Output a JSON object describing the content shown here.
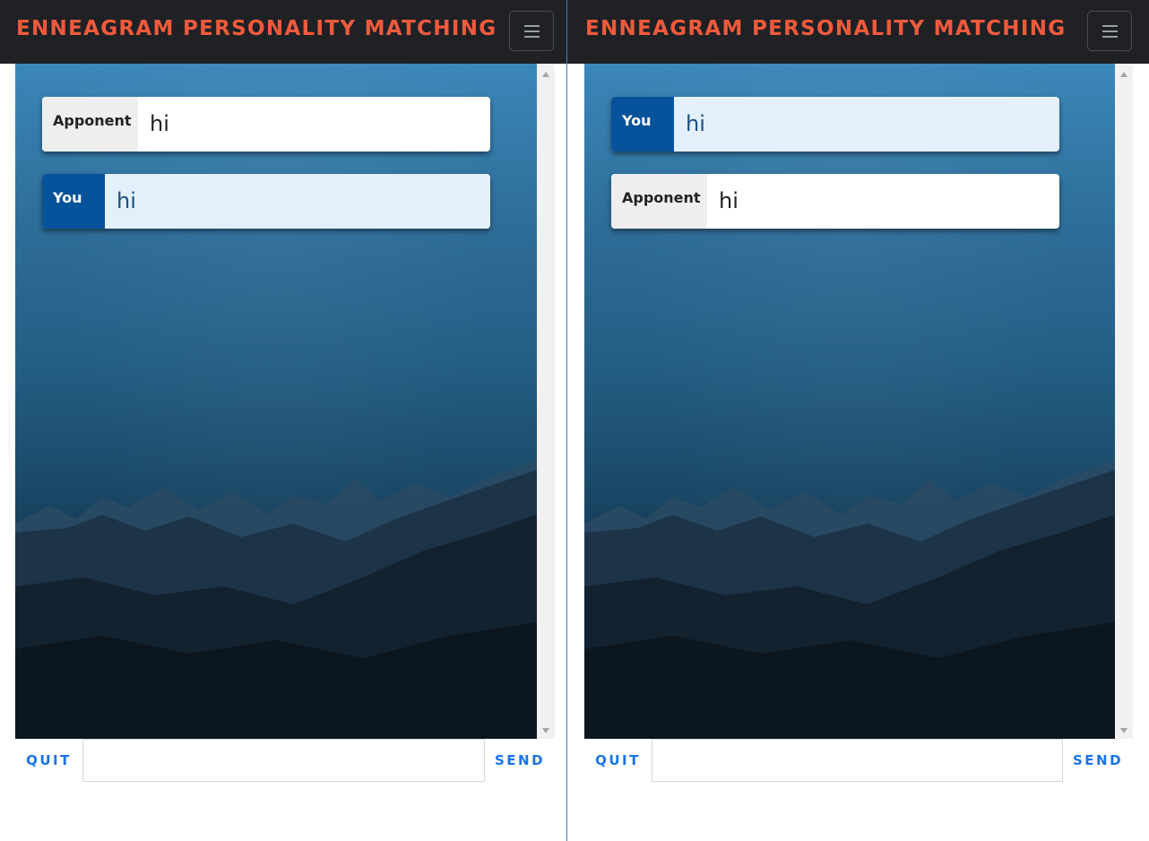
{
  "app": {
    "title": "ENNEAGRAM PERSONALITY MATCHING",
    "brand_color": "#f05a3c",
    "accent_color": "#1a73e8"
  },
  "panes": [
    {
      "menu_icon": "hamburger-menu-icon",
      "messages": [
        {
          "sender": "Apponent",
          "text": "hi"
        },
        {
          "sender": "You",
          "text": "hi"
        }
      ],
      "controls": {
        "quit_label": "QUIT",
        "send_label": "SEND",
        "input_value": ""
      }
    },
    {
      "menu_icon": "hamburger-menu-icon",
      "messages": [
        {
          "sender": "You",
          "text": "hi"
        },
        {
          "sender": "Apponent",
          "text": "hi"
        }
      ],
      "controls": {
        "quit_label": "QUIT",
        "send_label": "SEND",
        "input_value": ""
      }
    }
  ]
}
